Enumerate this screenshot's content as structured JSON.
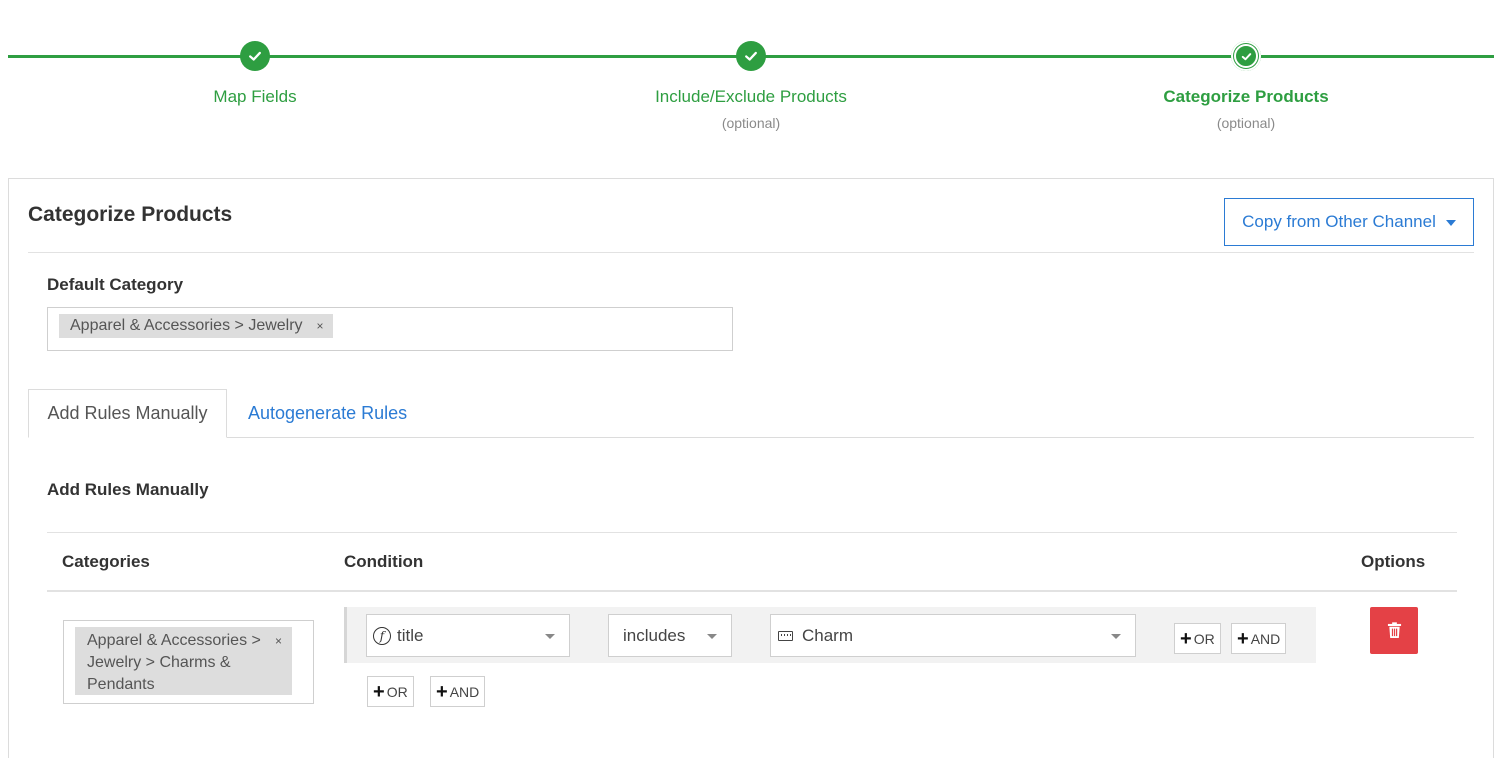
{
  "stepper": {
    "steps": [
      {
        "label": "Map Fields",
        "sub": "",
        "status": "complete"
      },
      {
        "label": "Include/Exclude Products",
        "sub": "(optional)",
        "status": "complete"
      },
      {
        "label": "Categorize Products",
        "sub": "(optional)",
        "status": "active"
      }
    ],
    "color": "#2e9e41"
  },
  "panel": {
    "title": "Categorize Products",
    "copy_button": "Copy from Other Channel"
  },
  "default_category": {
    "label": "Default Category",
    "selected": "Apparel & Accessories > Jewelry",
    "remove": "×"
  },
  "tabs": [
    {
      "label": "Add Rules Manually",
      "active": true
    },
    {
      "label": "Autogenerate Rules",
      "active": false
    }
  ],
  "rules": {
    "title": "Add Rules Manually",
    "headers": {
      "categories": "Categories",
      "condition": "Condition",
      "options": "Options"
    },
    "rows": [
      {
        "category": "Apparel & Accessories > Jewelry > Charms & Pendants",
        "remove": "×",
        "field": "title",
        "operator": "includes",
        "value": "Charm",
        "inner_or": "OR",
        "inner_and": "AND",
        "outer_or": "OR",
        "outer_and": "AND"
      }
    ]
  },
  "colors": {
    "accent_blue": "#2b7bd4",
    "danger": "#e44146"
  }
}
